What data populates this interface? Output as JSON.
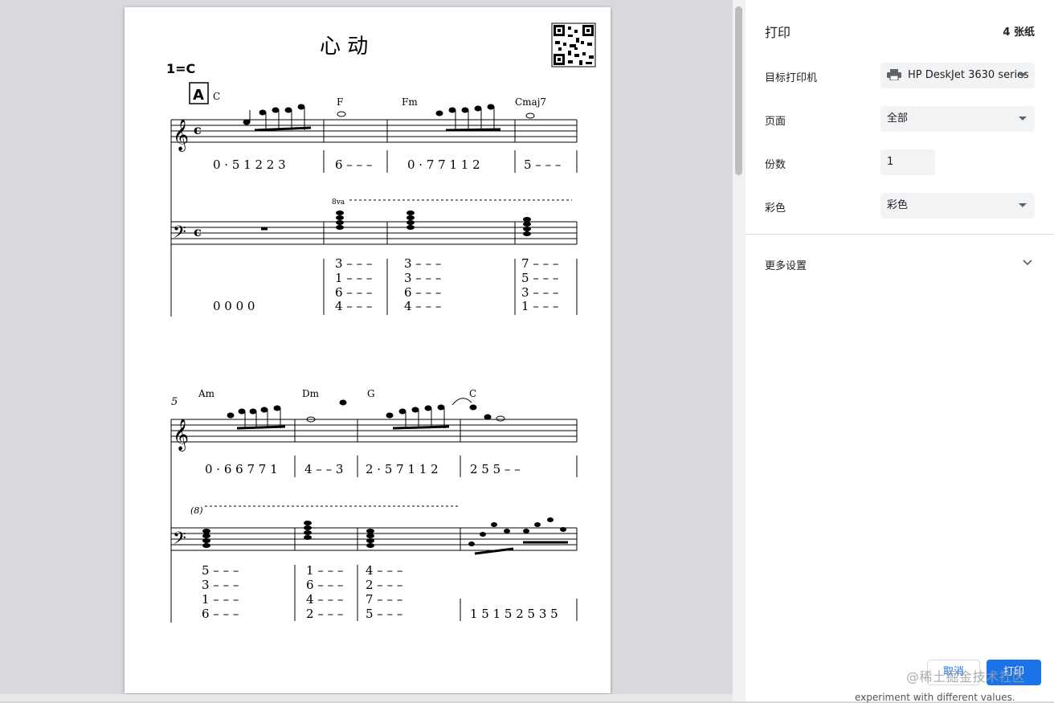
{
  "dialog": {
    "title": "打印",
    "sheet_count": "4 张纸",
    "destination_label": "目标打印机",
    "destination_value": "HP DeskJet 3630 series",
    "pages_label": "页面",
    "pages_value": "全部",
    "copies_label": "份数",
    "copies_value": "1",
    "color_label": "彩色",
    "color_value": "彩色",
    "more_settings": "更多设置",
    "cancel_label": "取消",
    "print_label": "打印"
  },
  "watermark": "@稀土掘金技术社区",
  "bottom_text": "experiment with different values.",
  "score": {
    "title": "心  动",
    "key": "1=C",
    "section_mark": "A",
    "octave_mark": "8va",
    "octave_mark2": "(8)",
    "measure_number_2": "5",
    "chords_row1": [
      "C",
      "F",
      "Fm",
      "Cmaj7"
    ],
    "chords_row2": [
      "Am",
      "Dm",
      "G",
      "C"
    ],
    "jianpu_row1": [
      "0 · 5 1 2 2 3",
      "6 – – –",
      "0 · 7 7 1 1 2",
      "5 – – –"
    ],
    "bass_row1": [
      "0  0  0  0",
      "3 – – –",
      "3  –  –  –",
      "7 – – –"
    ],
    "jianpu_row2": [
      "0 · 6 6 7 7 1",
      "4 – – 3",
      "2 · 5 7 1 1 2",
      "2 5 5   –  –"
    ],
    "bass_row2": [
      "5  –  –  –",
      "1 – – –",
      "4  –  –  –",
      "1 5 1 5 2 5 3 5"
    ]
  }
}
